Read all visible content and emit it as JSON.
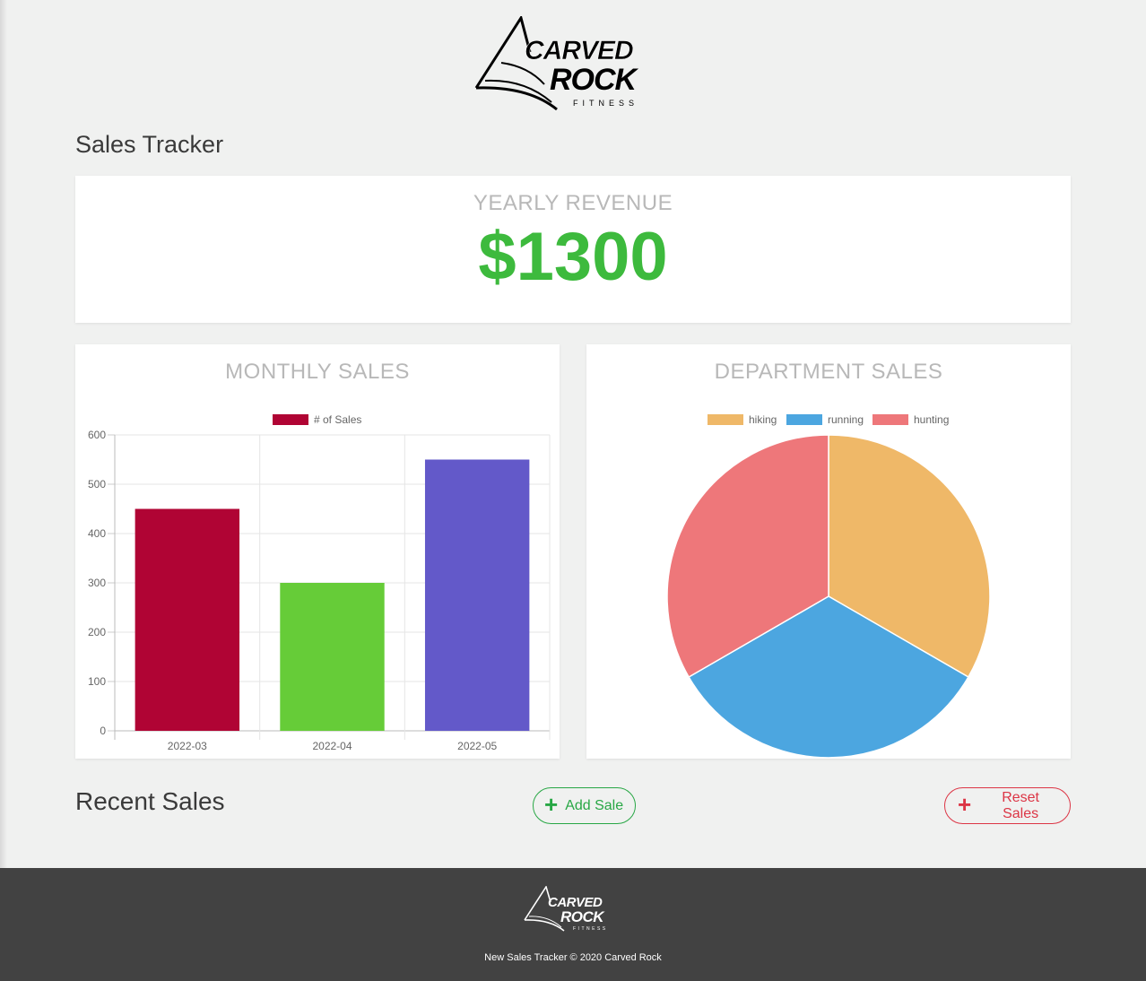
{
  "brand": {
    "logo_line1": "CARVED",
    "logo_line2": "ROCK",
    "logo_line3": "FITNESS"
  },
  "page": {
    "title": "Sales Tracker"
  },
  "revenue": {
    "heading": "YEARLY REVENUE",
    "value": "$1300",
    "color": "#3dba3d"
  },
  "monthly": {
    "heading": "MONTHLY SALES"
  },
  "department": {
    "heading": "DEPARTMENT SALES"
  },
  "chart_data": [
    {
      "type": "bar",
      "title": "MONTHLY SALES",
      "categories": [
        "2022-03",
        "2022-04",
        "2022-05"
      ],
      "series": [
        {
          "name": "# of Sales",
          "values": [
            450,
            300,
            550
          ],
          "colors": [
            "#b00434",
            "#66cc38",
            "#6359c9"
          ]
        }
      ],
      "legend_color": "#b00434",
      "y_ticks": [
        0,
        100,
        200,
        300,
        400,
        500,
        600
      ],
      "ylim": [
        0,
        600
      ],
      "grid": true,
      "legend": "top"
    },
    {
      "type": "pie",
      "title": "DEPARTMENT SALES",
      "labels": [
        "hiking",
        "running",
        "hunting"
      ],
      "values": [
        1,
        1,
        1
      ],
      "colors": [
        "#efb868",
        "#4ca6e0",
        "#ee777a"
      ],
      "legend": "top"
    }
  ],
  "recent": {
    "title": "Recent Sales",
    "add_label": "Add Sale",
    "reset_label": "Reset Sales",
    "add_icon": "plus-icon",
    "reset_icon": "plus-icon"
  },
  "footer": {
    "text": "New Sales Tracker © 2020 Carved Rock"
  }
}
